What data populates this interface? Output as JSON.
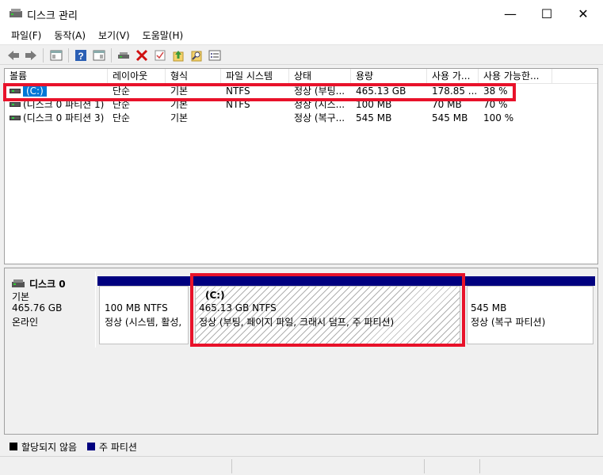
{
  "window": {
    "title": "디스크 관리",
    "minimize_glyph": "—",
    "maximize_glyph": "☐",
    "close_glyph": "✕"
  },
  "menu": [
    "파일(F)",
    "동작(A)",
    "보기(V)",
    "도움말(H)"
  ],
  "toolbar": {
    "icons": [
      "back-icon",
      "forward-icon",
      "console-tree-icon",
      "help-icon",
      "properties-icon",
      "connect-icon",
      "delete-icon",
      "check-icon",
      "up-icon",
      "search-icon",
      "details-icon"
    ]
  },
  "volume_list": {
    "columns": [
      "볼륨",
      "레이아웃",
      "형식",
      "파일 시스템",
      "상태",
      "용량",
      "사용 가...",
      "사용 가능한..."
    ],
    "rows": [
      {
        "volume": "(C:)",
        "layout": "단순",
        "type": "기본",
        "fs": "NTFS",
        "status": "정상 (부팅...",
        "capacity": "465.13 GB",
        "free": "178.85 ...",
        "pct": "38 %",
        "selected": true
      },
      {
        "volume": "(디스크 0 파티션 1)",
        "layout": "단순",
        "type": "기본",
        "fs": "NTFS",
        "status": "정상 (시스...",
        "capacity": "100 MB",
        "free": "70 MB",
        "pct": "70 %",
        "selected": false
      },
      {
        "volume": "(디스크 0 파티션 3)",
        "layout": "단순",
        "type": "기본",
        "fs": "",
        "status": "정상 (복구...",
        "capacity": "545 MB",
        "free": "545 MB",
        "pct": "100 %",
        "selected": false
      }
    ]
  },
  "disk": {
    "name": "디스크 0",
    "type": "기본",
    "size": "465.76 GB",
    "state": "온라인",
    "partitions": [
      {
        "label": "",
        "size_fs": "100 MB NTFS",
        "status": "정상 (시스템, 활성,"
      },
      {
        "label": "(C:)",
        "size_fs": "465.13 GB NTFS",
        "status": "정상 (부팅, 페이지 파일, 크래시 덤프, 주 파티션)"
      },
      {
        "label": "",
        "size_fs": "545 MB",
        "status": "정상 (복구 파티션)"
      }
    ]
  },
  "legend": [
    {
      "label": "할당되지 않음",
      "color": "#000000"
    },
    {
      "label": "주 파티션",
      "color": "#00007f"
    }
  ],
  "colors": {
    "highlight": "#e8122a",
    "selection": "#0078d7",
    "primary_partition": "#00007f"
  }
}
